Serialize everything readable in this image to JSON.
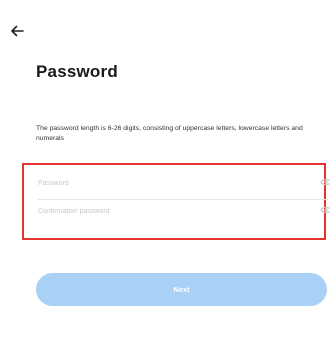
{
  "header": {
    "back_icon": "arrow-left-icon"
  },
  "title": "Password",
  "hint": "The password length is 6-26 digits, consisting of uppercase letters, lowercase letters and numerals",
  "form": {
    "password": {
      "placeholder": "Password",
      "value": "",
      "toggle_icon": "eye-icon"
    },
    "confirm": {
      "placeholder": "Confirmation password",
      "value": "",
      "toggle_icon": "eye-icon"
    },
    "highlight_color": "#e2332e"
  },
  "next_button": {
    "label": "Next",
    "color": "#a9d1f6",
    "enabled": false
  }
}
